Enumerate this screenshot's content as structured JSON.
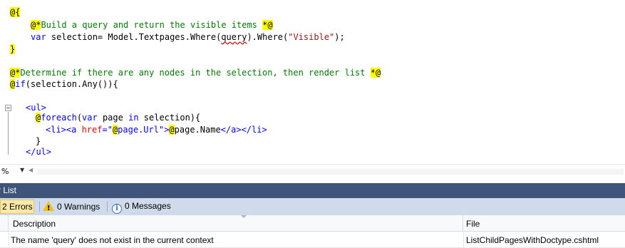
{
  "code": {
    "l1_open": "@{",
    "l2_comment": "@*Build a query and return the visible items *@",
    "l3_var": "var",
    "l3_a": " selection= Model.Textpages.Where(",
    "l3_query": "query",
    "l3_b": ").Where(",
    "l3_str": "\"Visible\"",
    "l3_c": ");",
    "l4_close": "}",
    "l6_comment": "@*Determine if there are any nodes in the selection, then render list *@",
    "l7_at": "@",
    "l7_if": "if",
    "l7_rest": "(selection.Any()){",
    "l9_ul": "<ul>",
    "l10_at": "@",
    "l10_foreach": "foreach",
    "l10_a": "(",
    "l10_var": "var",
    "l10_b": " page ",
    "l10_in": "in",
    "l10_c": " selection){",
    "l11_li": "<li>",
    "l11_atag": "<a",
    "l11_href": " href",
    "l11_eq": "=\"",
    "l11_at1": "@",
    "l11_url": "page.Url",
    "l11_q": "\">",
    "l11_at2": "@",
    "l11_name": "page.Name",
    "l11_end": "</a></li>",
    "l12_close": "}",
    "l13_ul_close": "</ul>"
  },
  "zoom": {
    "value": "%"
  },
  "error_list": {
    "title": "r List",
    "errors_label": "2 Errors",
    "warnings_label": "0 Warnings",
    "messages_label": "0 Messages",
    "columns": {
      "description": "Description",
      "file": "File"
    },
    "rows": [
      {
        "description": "The name 'query' does not exist in the current context",
        "file": "ListChildPagesWithDoctype.cshtml"
      }
    ]
  },
  "colors": {
    "highlight": "#ffff00",
    "comment": "#008000",
    "keyword": "#0000ff",
    "string": "#a31515",
    "panel_title_bg": "#3e5478",
    "toolbar_bg": "#cfdbeb"
  }
}
